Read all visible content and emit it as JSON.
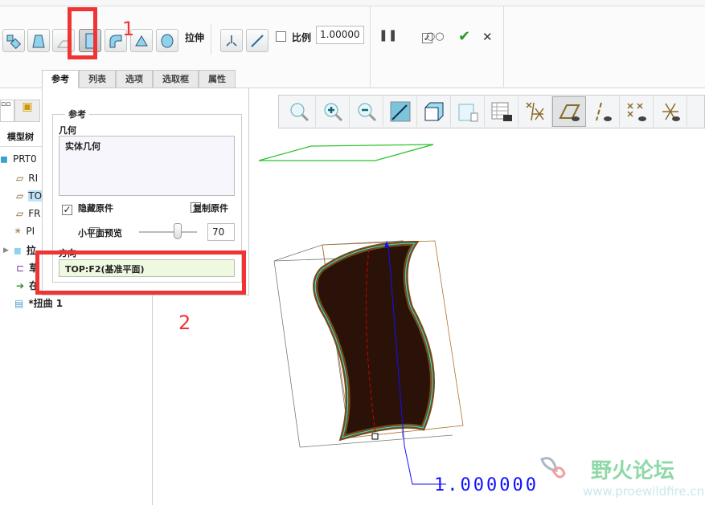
{
  "ribbon": {
    "feature_label": "拉伸",
    "scale_label": "比例",
    "scale_value": "1.00000",
    "scale_checked": false,
    "preview_checked": true,
    "ok": "✔",
    "cancel": "✕",
    "pause": "❚❚"
  },
  "tabs": [
    {
      "label": "参考"
    },
    {
      "label": "列表"
    },
    {
      "label": "选项"
    },
    {
      "label": "选取框"
    },
    {
      "label": "属性"
    }
  ],
  "panel": {
    "group_title": "参考",
    "geometry_label": "几何",
    "geometry_item": "实体几何",
    "hide_original_label": "隐藏原件",
    "hide_original_checked": true,
    "copy_original_label": "复制原件",
    "copy_original_checked": false,
    "small_plane_label": "小平面预览",
    "small_plane_checked": false,
    "slider_value": 70,
    "slider_text": "70",
    "direction_label": "方向",
    "direction_value": "TOP:F2(基准平面)"
  },
  "tree": {
    "tab_label": "模型树",
    "items": [
      {
        "label": "PRT0"
      },
      {
        "label": "RI"
      },
      {
        "label": "TO"
      },
      {
        "label": "FR"
      },
      {
        "label": "PI"
      },
      {
        "label": "拉"
      },
      {
        "label": "草"
      },
      {
        "label": "在"
      },
      {
        "label": "*扭曲 1"
      }
    ]
  },
  "annotations": {
    "one": "1",
    "two": "2"
  },
  "viewport": {
    "dimension": "1.000000"
  },
  "watermark": {
    "title": "野火论坛",
    "url": "www.proewildfire.cn"
  }
}
